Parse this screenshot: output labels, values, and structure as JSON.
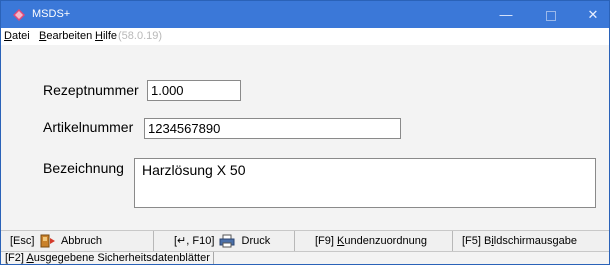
{
  "window": {
    "title": "MSDS+",
    "accent": "#3b78d8",
    "controls": {
      "minimize": "—",
      "close": "✕"
    }
  },
  "menu": {
    "items": [
      {
        "label_hot": "D",
        "label_rest": "atei"
      },
      {
        "label_hot": "B",
        "label_rest": "earbeiten"
      },
      {
        "label_hot": "H",
        "label_rest": "ilfe"
      }
    ],
    "version": "(58.0.19)"
  },
  "form": {
    "rezeptnummer_label": "Rezeptnummer",
    "rezeptnummer_value": "1.000",
    "artikelnummer_label": "Artikelnummer",
    "artikelnummer_value": "1234567890",
    "bezeichnung_label": "Bezeichnung",
    "bezeichnung_value": "Harzlösung X 50"
  },
  "toolbar": {
    "abbruch_key": "[Esc]",
    "abbruch_label": "Abbruch",
    "druck_key": "[↵, F10]",
    "druck_label": "Druck",
    "kunden_key": "[F9] ",
    "kunden_hot": "K",
    "kunden_rest": "undenzuordnung",
    "bild_key": "[F5] B",
    "bild_hot": "i",
    "bild_rest": "ldschirmausgabe"
  },
  "status": {
    "key": "[F2] ",
    "hot": "A",
    "rest": "usgegebene Sicherheitsdatenblätter"
  },
  "icons": {
    "app": "msds-app-icon",
    "abbruch": "exit-door-icon",
    "druck": "printer-icon"
  }
}
